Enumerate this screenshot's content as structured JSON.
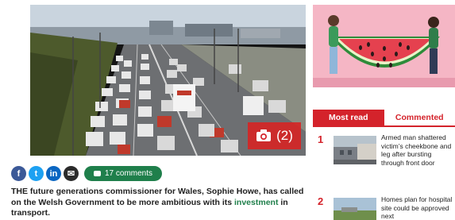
{
  "hero": {
    "photo_count": "(2)"
  },
  "share": {
    "facebook": "f",
    "twitter": "t",
    "linkedin": "in",
    "email": "✉",
    "comments_label": "17 comments"
  },
  "article": {
    "lead_before": "THE future generations commissioner for Wales, Sophie Howe, has called on the Welsh Government to be more ambitious with its ",
    "lead_link": "investment",
    "lead_after": " in transport."
  },
  "sidebar": {
    "tabs": [
      {
        "label": "Most read",
        "active": true
      },
      {
        "label": "Commented",
        "active": false
      }
    ],
    "most_read": [
      {
        "rank": "1",
        "title": "Armed man shattered victim’s cheekbone and leg after bursting through front door"
      },
      {
        "rank": "2",
        "title": "Homes plan for hospital site could be approved next"
      }
    ]
  },
  "colors": {
    "brand_red": "#d4232b",
    "link_green": "#1f7f4b"
  },
  "icons": [
    "camera-icon",
    "facebook-icon",
    "twitter-icon",
    "linkedin-icon",
    "email-icon",
    "comment-icon"
  ]
}
